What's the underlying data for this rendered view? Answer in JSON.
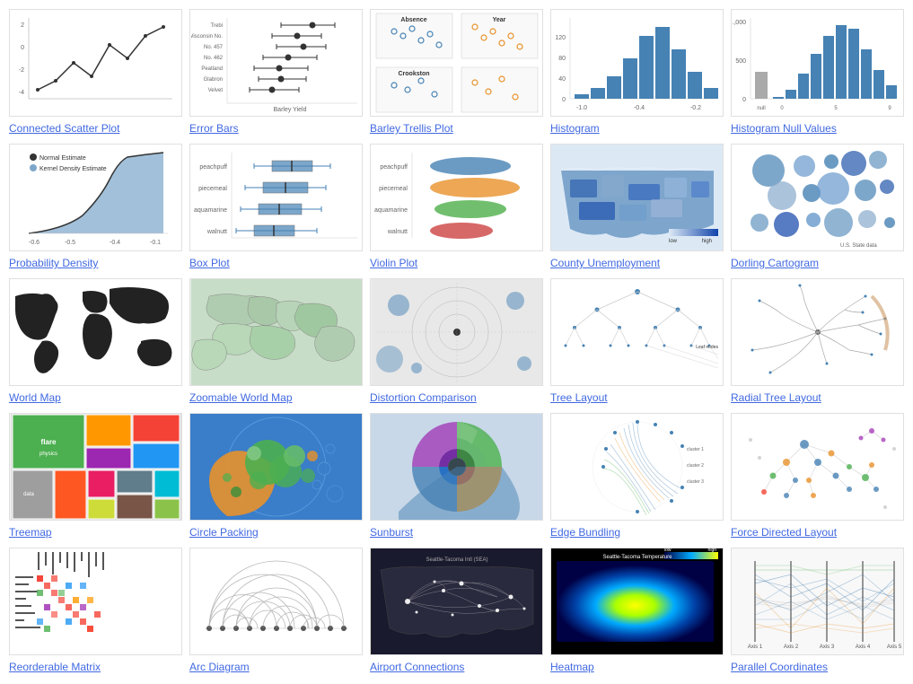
{
  "gallery": {
    "items": [
      {
        "id": "connected-scatter",
        "label": "Connected Scatter Plot",
        "thumb_class": "thumb-connected-scatter",
        "row": 1
      },
      {
        "id": "error-bars",
        "label": "Error Bars",
        "thumb_class": "thumb-error-bars",
        "row": 1
      },
      {
        "id": "barley-trellis",
        "label": "Barley Trellis Plot",
        "thumb_class": "thumb-barley",
        "row": 1
      },
      {
        "id": "histogram",
        "label": "Histogram",
        "thumb_class": "thumb-histogram",
        "row": 1
      },
      {
        "id": "histogram-null",
        "label": "Histogram Null Values",
        "thumb_class": "thumb-histogram-null",
        "row": 1
      },
      {
        "id": "probability-density",
        "label": "Probability Density",
        "thumb_class": "thumb-prob-density",
        "row": 2
      },
      {
        "id": "box-plot",
        "label": "Box Plot",
        "thumb_class": "thumb-box-plot",
        "row": 2
      },
      {
        "id": "violin-plot",
        "label": "Violin Plot",
        "thumb_class": "thumb-violin",
        "row": 2
      },
      {
        "id": "county-unemployment",
        "label": "County Unemployment",
        "thumb_class": "thumb-county",
        "row": 2
      },
      {
        "id": "dorling-cartogram",
        "label": "Dorling Cartogram",
        "thumb_class": "thumb-dorling",
        "row": 2
      },
      {
        "id": "world-map",
        "label": "World Map",
        "thumb_class": "thumb-world-map",
        "row": 3
      },
      {
        "id": "zoomable-world-map",
        "label": "Zoomable World Map",
        "thumb_class": "thumb-zoomable",
        "row": 3
      },
      {
        "id": "distortion-comparison",
        "label": "Distortion Comparison",
        "thumb_class": "thumb-distortion",
        "row": 3
      },
      {
        "id": "tree-layout",
        "label": "Tree Layout",
        "thumb_class": "thumb-tree",
        "row": 3
      },
      {
        "id": "radial-tree",
        "label": "Radial Tree Layout",
        "thumb_class": "thumb-radial-tree",
        "row": 3
      },
      {
        "id": "treemap",
        "label": "Treemap",
        "thumb_class": "thumb-treemap",
        "row": 4
      },
      {
        "id": "circle-packing",
        "label": "Circle Packing",
        "thumb_class": "thumb-circle-packing",
        "row": 4
      },
      {
        "id": "sunburst",
        "label": "Sunburst",
        "thumb_class": "thumb-sunburst",
        "row": 4
      },
      {
        "id": "edge-bundling",
        "label": "Edge Bundling",
        "thumb_class": "thumb-edge-bundling",
        "row": 4
      },
      {
        "id": "force-directed",
        "label": "Force Directed Layout",
        "thumb_class": "thumb-force",
        "row": 4
      },
      {
        "id": "reorderable-matrix",
        "label": "Reorderable Matrix",
        "thumb_class": "thumb-matrix",
        "row": 5
      },
      {
        "id": "arc-diagram",
        "label": "Arc Diagram",
        "thumb_class": "thumb-arc",
        "row": 5
      },
      {
        "id": "airport-connections",
        "label": "Airport Connections",
        "thumb_class": "thumb-airport",
        "row": 5
      },
      {
        "id": "heatmap",
        "label": "Heatmap",
        "thumb_class": "thumb-heatmap",
        "row": 5
      },
      {
        "id": "parallel-coordinates",
        "label": "Parallel Coordinates",
        "thumb_class": "thumb-parallel",
        "row": 5
      }
    ]
  }
}
